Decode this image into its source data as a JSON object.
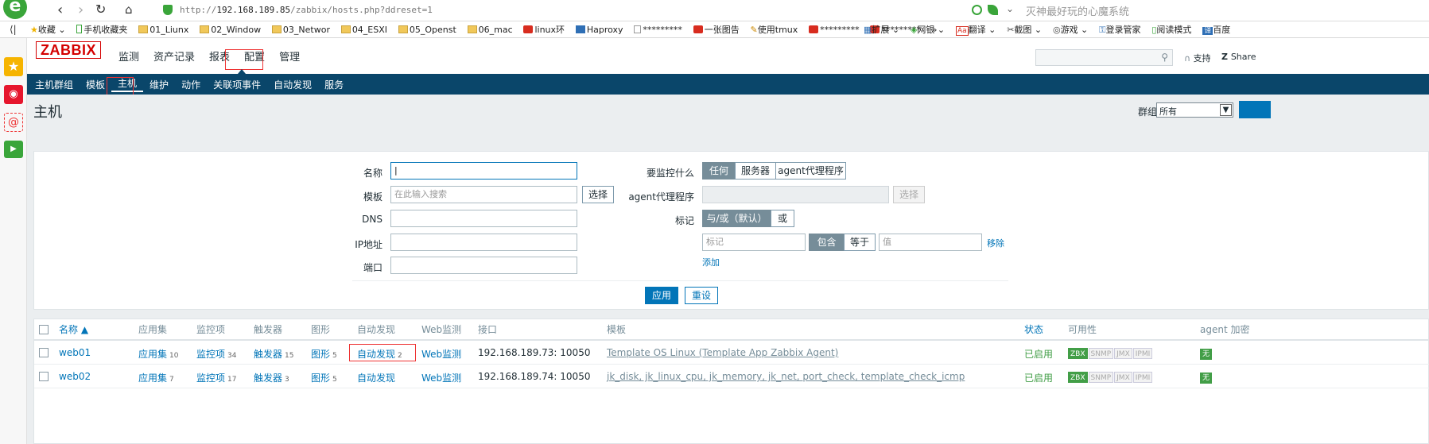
{
  "browser": {
    "url": "http://192.168.189.85/zabbix/hosts.php?ddreset=1",
    "url_prefix": "http://",
    "url_host": "192.168.189.85",
    "url_path": "/zabbix/hosts.php?ddreset=1",
    "search_hint": "灭神最好玩的心魔系统",
    "bookmarks": [
      "收藏",
      "手机收藏夹",
      "01_Liunx",
      "02_Window",
      "03_Networ",
      "04_ESXI",
      "05_Openst",
      "06_mac",
      "linux环",
      "Haproxy",
      "*********",
      "一张图告",
      "使用tmux",
      "*********",
      "*********"
    ],
    "tools": [
      "扩展",
      "网银",
      "翻译",
      "截图",
      "游戏",
      "登录管家",
      "阅读模式",
      "百度"
    ],
    "more": "»"
  },
  "app": {
    "logo": "ZABBIX",
    "main_nav": [
      "监测",
      "资产记录",
      "报表",
      "配置",
      "管理"
    ],
    "support": "支持",
    "share": "Share",
    "sub_nav": [
      "主机群组",
      "模板",
      "主机",
      "维护",
      "动作",
      "关联项事件",
      "自动发现",
      "服务"
    ],
    "page_title": "主机",
    "group_label": "群组",
    "group_value": "所有"
  },
  "filter": {
    "name_label": "名称",
    "template_label": "模板",
    "template_placeholder": "在此输入搜索",
    "select_btn": "选择",
    "dns_label": "DNS",
    "ip_label": "IP地址",
    "port_label": "端口",
    "monitor_label": "要监控什么",
    "monitor_opts": [
      "任何",
      "服务器",
      "agent代理程序"
    ],
    "proxy_label": "agent代理程序",
    "proxy_select": "选择",
    "tag_label": "标记",
    "tag_opts": [
      "与/或（默认）",
      "或"
    ],
    "tag_placeholder": "标记",
    "op_opts": [
      "包含",
      "等于"
    ],
    "value_placeholder": "值",
    "remove": "移除",
    "add": "添加",
    "apply": "应用",
    "reset": "重设"
  },
  "table": {
    "headers": [
      "名称 ▲",
      "应用集",
      "监控项",
      "触发器",
      "图形",
      "自动发现",
      "Web监测",
      "接口",
      "模板",
      "状态",
      "可用性",
      "agent 加密"
    ],
    "rows": [
      {
        "name": "web01",
        "apps": "应用集",
        "apps_n": "10",
        "items": "监控项",
        "items_n": "34",
        "triggers": "触发器",
        "triggers_n": "15",
        "graphs": "图形",
        "graphs_n": "5",
        "discovery": "自动发现",
        "discovery_n": "2",
        "web": "Web监测",
        "iface": "192.168.189.73: 10050",
        "templates": "Template OS Linux (Template App Zabbix Agent)",
        "status": "已启用",
        "avail": [
          "ZBX",
          "SNMP",
          "JMX",
          "IPMI"
        ],
        "enc": "无"
      },
      {
        "name": "web02",
        "apps": "应用集",
        "apps_n": "7",
        "items": "监控项",
        "items_n": "17",
        "triggers": "触发器",
        "triggers_n": "3",
        "graphs": "图形",
        "graphs_n": "5",
        "discovery": "自动发现",
        "discovery_n": "",
        "web": "Web监测",
        "iface": "192.168.189.74: 10050",
        "templates": "jk_disk, jk_linux_cpu, jk_memory, jk_net, port_check, template_check_icmp",
        "status": "已启用",
        "avail": [
          "ZBX",
          "SNMP",
          "JMX",
          "IPMI"
        ],
        "enc": "无"
      }
    ]
  },
  "colors": {
    "accent": "#0a466a",
    "link": "#0275b8",
    "enabled": "#429e47",
    "logo_red": "#d40000",
    "highlight_red": "#ee3333"
  }
}
